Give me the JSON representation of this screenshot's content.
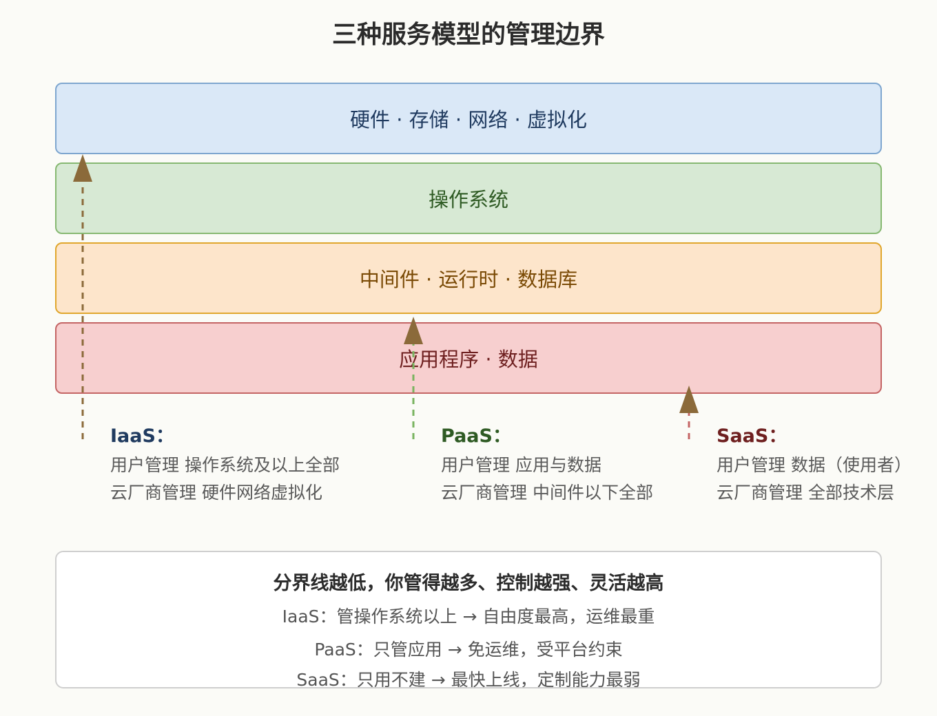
{
  "title": "三种服务模型的管理边界",
  "layers": [
    {
      "label": "硬件 · 存储 · 网络 · 虚拟化",
      "fill": "#dae8f7",
      "stroke": "#7ea6cf",
      "text_color": "#1f3a5f"
    },
    {
      "label": "操作系统",
      "fill": "#d7e9d4",
      "stroke": "#86b871",
      "text_color": "#2e5a23"
    },
    {
      "label": "中间件 · 运行时 · 数据库",
      "fill": "#fde5cb",
      "stroke": "#e0a62c",
      "text_color": "#7a4a05"
    },
    {
      "label": "应用程序 · 数据",
      "fill": "#f7cfcf",
      "stroke": "#c46464",
      "text_color": "#6e1f1f"
    }
  ],
  "models": [
    {
      "name": "IaaS：",
      "name_color": "#1f3a5f",
      "line1": "用户管理 操作系统及以上全部",
      "line2": "云厂商管理 硬件网络虚拟化",
      "arrow_color": "#8b6a3a",
      "dash_color": "#8b6a3a"
    },
    {
      "name": "PaaS：",
      "name_color": "#2e5a23",
      "line1": "用户管理 应用与数据",
      "line2": "云厂商管理 中间件以下全部",
      "arrow_color": "#8b6a3a",
      "dash_color": "#78b35f"
    },
    {
      "name": "SaaS：",
      "name_color": "#6e1f1f",
      "line1": "用户管理 数据（使用者）",
      "line2": "云厂商管理 全部技术层",
      "arrow_color": "#8b6a3a",
      "dash_color": "#c46464"
    }
  ],
  "summary": {
    "title": "分界线越低，你管得越多、控制越强、灵活越高",
    "lines": [
      "IaaS：管操作系统以上 → 自由度最高，运维最重",
      "PaaS：只管应用 → 免运维，受平台约束",
      "SaaS：只用不建 → 最快上线，定制能力最弱"
    ]
  }
}
